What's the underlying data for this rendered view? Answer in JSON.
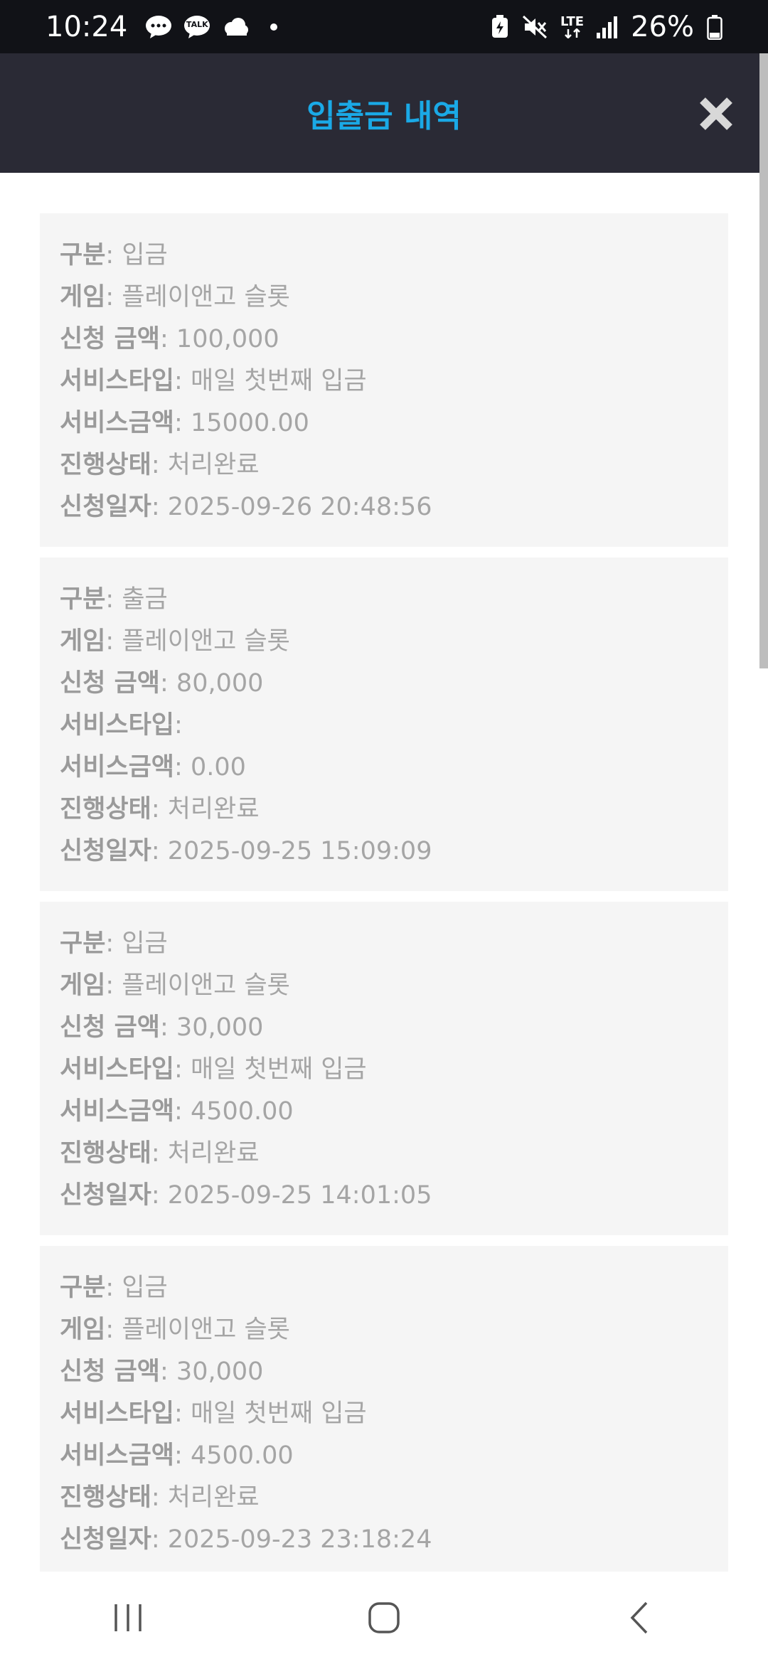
{
  "status_bar": {
    "time": "10:24",
    "notif_icons": [
      "chat-bubble-icon",
      "kakaotalk-icon",
      "cloud-icon",
      "dot-icon"
    ],
    "kakao_label": "TALK",
    "lte_label": "LTE",
    "battery_percent": "26%"
  },
  "header": {
    "title": "입출금 내역"
  },
  "labels": {
    "type": "구분",
    "game": "게임",
    "amount": "신청 금액",
    "service_type": "서비스타입",
    "service_amount": "서비스금액",
    "status": "진행상태",
    "date": "신청일자",
    "sep": ": "
  },
  "records": [
    {
      "type": "입금",
      "game": "플레이앤고 슬롯",
      "amount": "100,000",
      "service_type": "매일 첫번째 입금",
      "service_amount": "15000.00",
      "status": "처리완료",
      "date": "2025-09-26 20:48:56"
    },
    {
      "type": "출금",
      "game": "플레이앤고 슬롯",
      "amount": "80,000",
      "service_type": "",
      "service_amount": "0.00",
      "status": "처리완료",
      "date": "2025-09-25 15:09:09"
    },
    {
      "type": "입금",
      "game": "플레이앤고 슬롯",
      "amount": "30,000",
      "service_type": "매일 첫번째 입금",
      "service_amount": "4500.00",
      "status": "처리완료",
      "date": "2025-09-25 14:01:05"
    },
    {
      "type": "입금",
      "game": "플레이앤고 슬롯",
      "amount": "30,000",
      "service_type": "매일 첫번째 입금",
      "service_amount": "4500.00",
      "status": "처리완료",
      "date": "2025-09-23 23:18:24"
    }
  ],
  "nav": [
    "recent-apps-icon",
    "home-icon",
    "back-icon"
  ]
}
